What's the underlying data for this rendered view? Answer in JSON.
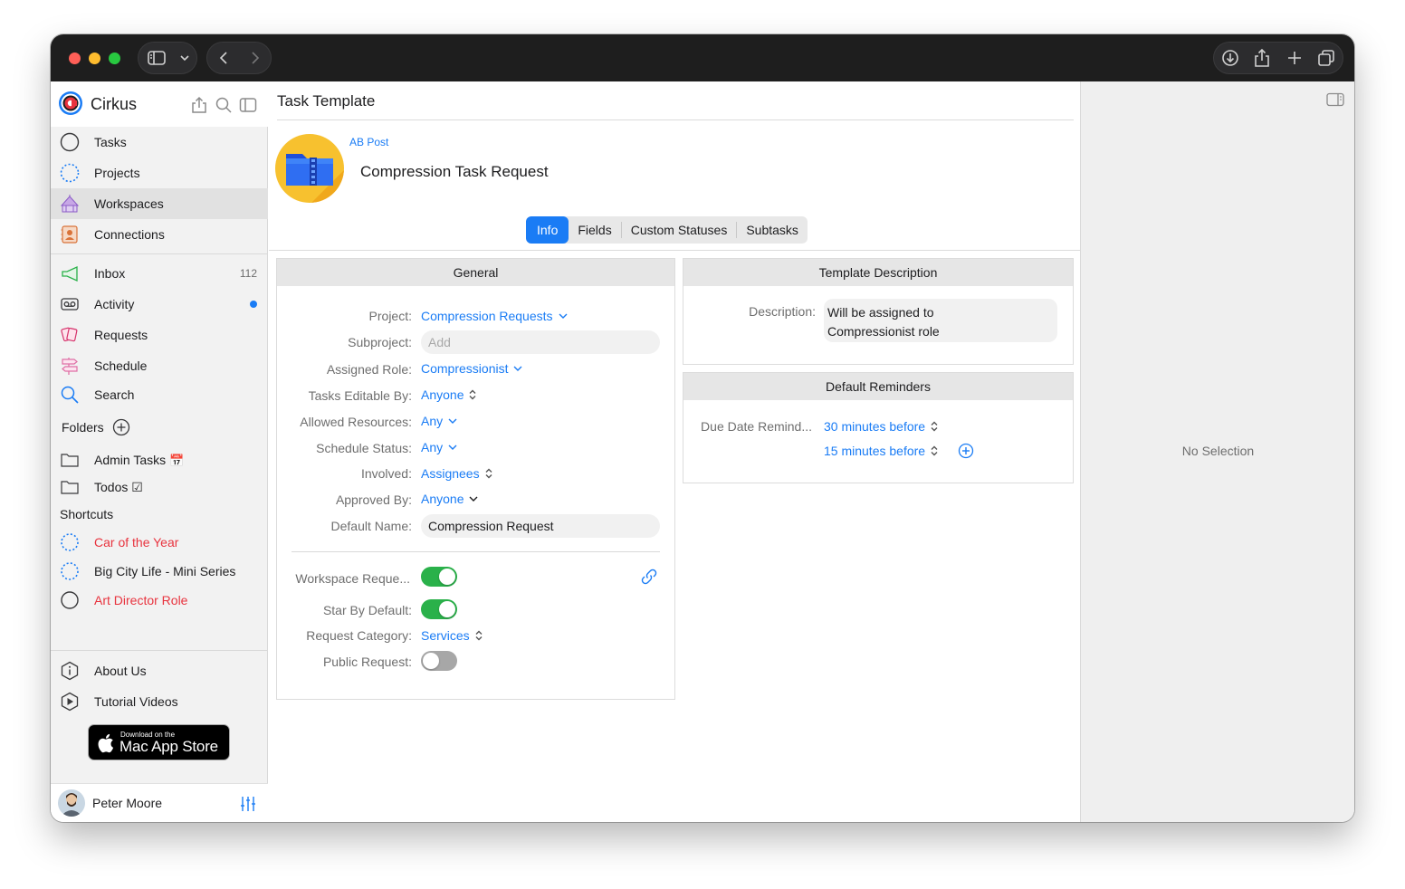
{
  "sidebar": {
    "app_name": "Cirkus",
    "nav": [
      {
        "label": "Tasks",
        "icon": "circle-icon"
      },
      {
        "label": "Projects",
        "icon": "dotted-circle-icon"
      },
      {
        "label": "Workspaces",
        "icon": "circus-tent-icon",
        "selected": true
      },
      {
        "label": "Connections",
        "icon": "contacts-icon"
      }
    ],
    "nav2": [
      {
        "label": "Inbox",
        "icon": "megaphone-icon",
        "count": "112"
      },
      {
        "label": "Activity",
        "icon": "voicemail-icon",
        "unread": true
      },
      {
        "label": "Requests",
        "icon": "cards-icon"
      },
      {
        "label": "Schedule",
        "icon": "signpost-icon"
      },
      {
        "label": "Search",
        "icon": "search-icon"
      }
    ],
    "folders_title": "Folders",
    "folders": [
      {
        "label": "Admin Tasks",
        "emoji": "📅"
      },
      {
        "label": "Todos",
        "emoji": "☑"
      }
    ],
    "shortcuts_title": "Shortcuts",
    "shortcuts": [
      {
        "label": "Car of the Year",
        "icon": "dotted-circle-icon",
        "color": "#e8333e"
      },
      {
        "label": "Big City Life - Mini Series",
        "icon": "dotted-circle-icon",
        "color": "#1d1d1f"
      },
      {
        "label": "Art Director Role",
        "icon": "circle-icon",
        "color": "#e8333e"
      }
    ],
    "footer_links": [
      {
        "label": "About Us",
        "icon": "info-hexagon-icon"
      },
      {
        "label": "Tutorial Videos",
        "icon": "play-hexagon-icon"
      }
    ],
    "appstore_small": "Download on the",
    "appstore_big": "Mac App Store",
    "user_name": "Peter Moore"
  },
  "main": {
    "title": "Task Template",
    "breadcrumb": "AB Post",
    "task_name": "Compression Task Request",
    "tabs": [
      "Info",
      "Fields",
      "Custom Statuses",
      "Subtasks"
    ],
    "active_tab": "Info",
    "general": {
      "title": "General",
      "project_label": "Project:",
      "project_value": "Compression Requests",
      "subproject_label": "Subproject:",
      "subproject_placeholder": "Add",
      "role_label": "Assigned Role:",
      "role_value": "Compressionist",
      "editable_label": "Tasks Editable By:",
      "editable_value": "Anyone",
      "resources_label": "Allowed Resources:",
      "resources_value": "Any",
      "schedule_label": "Schedule Status:",
      "schedule_value": "Any",
      "involved_label": "Involved:",
      "involved_value": "Assignees",
      "approved_label": "Approved By:",
      "approved_value": "Anyone",
      "default_name_label": "Default Name:",
      "default_name_value": "Compression Request",
      "workspace_request_label": "Workspace Reque...",
      "workspace_request_on": true,
      "star_label": "Star By Default:",
      "star_on": true,
      "category_label": "Request Category:",
      "category_value": "Services",
      "public_label": "Public Request:",
      "public_on": false
    },
    "description": {
      "title": "Template Description",
      "label": "Description:",
      "line1": "Will be assigned to",
      "line2": "Compressionist role"
    },
    "reminders": {
      "title": "Default Reminders",
      "label": "Due Date Remind...",
      "items": [
        "30 minutes before",
        "15 minutes before"
      ]
    }
  },
  "inspector": {
    "empty_text": "No Selection"
  },
  "colors": {
    "accent": "#1a7cf5",
    "toggle_on": "#2ab14a",
    "shortcut_red": "#e8333e",
    "titlebar": "#1e1e1e"
  }
}
